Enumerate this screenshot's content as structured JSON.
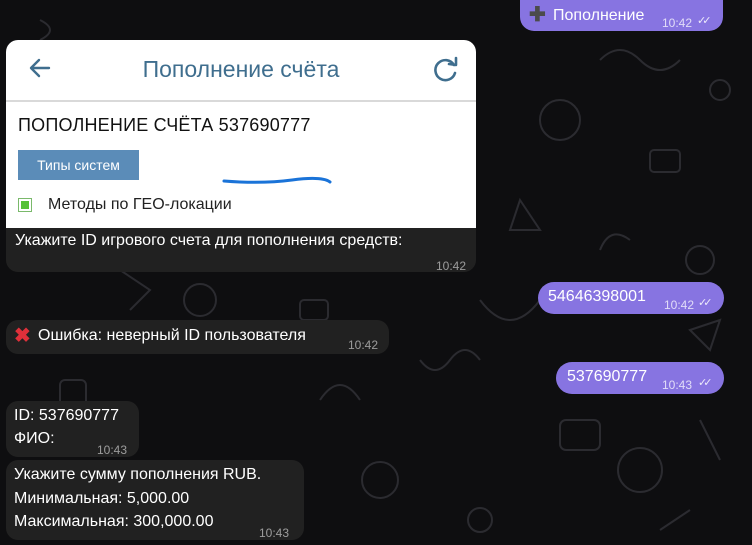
{
  "messages": {
    "out1": {
      "icon": "plus-icon",
      "text": "Пополнение",
      "time": "10:42"
    },
    "out2": {
      "text": "54646398001",
      "time": "10:42"
    },
    "out3": {
      "text": "537690777",
      "time": "10:43"
    },
    "card": {
      "title": "Пополнение счёта",
      "heading_prefix": "ПОПОЛНЕНИЕ СЧЁТА",
      "heading_id": "537690777",
      "button": "Типы систем",
      "geo_label": "Методы по ГЕО-локации"
    },
    "prompt_id": {
      "text": "Укажите ID игрового счета для пополнения средств:",
      "time": "10:42"
    },
    "error": {
      "icon": "red-cross-icon",
      "text": "Ошибка: неверный ID пользователя",
      "time": "10:42"
    },
    "info": {
      "line1": "ID: 537690777",
      "line2": "ФИО:",
      "time": "10:43"
    },
    "amount": {
      "line1": "Укажите сумму пополнения RUB.",
      "line2": "Минимальная: 5,000.00",
      "line3": "Максимальная: 300,000.00",
      "time": "10:43"
    }
  },
  "colors": {
    "background": "#0e0e10",
    "incoming_bubble": "#212121",
    "outgoing_bubble": "#8774e1",
    "card_title": "#3f6e8e",
    "card_button": "#5b8cb8",
    "underline": "#1a73d8"
  }
}
